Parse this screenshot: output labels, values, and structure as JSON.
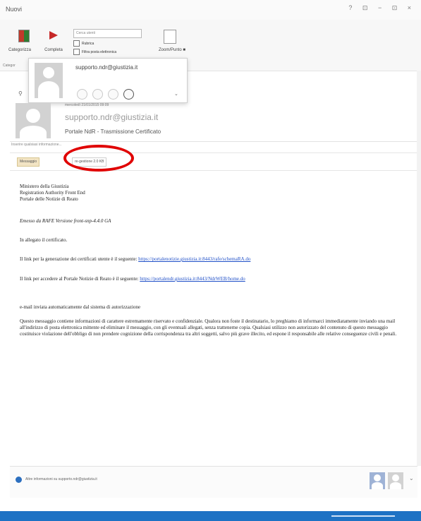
{
  "window": {
    "title": "Nuovi",
    "controls": "? ⊡ − ⊡ ×"
  },
  "ribbon": {
    "categorize_label": "Categorizza",
    "followup_label": "Completa",
    "search_placeholder": "Cerca utenti",
    "check1_label": "Rubrica",
    "check2_label": "Filtra posta elettronica",
    "zoom_label": "Zoom/Punto ■",
    "group_label": "Categor"
  },
  "popup": {
    "email": "supporto.ndr@giustizia.it"
  },
  "message": {
    "date": "mercoledì 21/01/2015 09:09",
    "sender": "supporto.ndr@giustizia.it",
    "subject": "Portale NdR - Trasmissione Certificato",
    "info_line": "Inserire qualsiasi informazione..."
  },
  "attachments": {
    "message_tab": "Messaggio",
    "file": "re-gestione 2.0 KB"
  },
  "body": {
    "line1": "Ministero della Giustizia",
    "line2": "Registration Authority Front End",
    "line3": "Portale delle Notizie di Reato",
    "sent_by": "Emesso da RAFE Versione front-snp-4.4.0 GA",
    "attached_cert": "In allegato il certificato.",
    "link1_text": "Il link per la generazione dei certificati utente è il seguente:",
    "link1_url": "https://portalenotizie.giustizia.it:8443/rafe/schemaRA.do",
    "link2_text": "Il link per accedere al Portale Notizie di Reato è il seguente:",
    "link2_url": "https://portalendr.giustizia.it:8443/NdrWEB/home.do",
    "auto_email": "e-mail inviata automaticamente dal sistema di autorizzazione",
    "disclaimer": "Questo messaggio contiene informazioni di carattere estremamente riservato e confidenziale. Qualora non foste il destinatario, lo preghiamo di informarci immediatamente inviando una mail all'indirizzo di posta elettronica mittente ed eliminare il messaggio, con gli eventuali allegati, senza trattenerne copia. Qualsiasi utilizzo non autorizzato del contenuto di questo messaggio costituisce violazione dell'obbligo di non prendere cognizione della corrispondenza tra altri soggetti, salvo più grave illecito, ed espone il responsabile alle relative conseguenze civili e penali."
  },
  "footer": {
    "info": "Altre informazioni su supporto.ndr@giustizia.it"
  }
}
